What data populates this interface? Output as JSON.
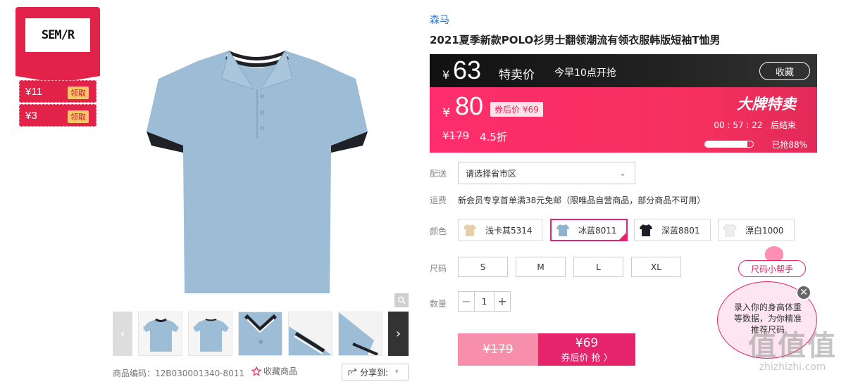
{
  "brand_badge": {
    "logo": "SEM/R"
  },
  "coupons": [
    {
      "amount": "¥11",
      "action": "领取"
    },
    {
      "amount": "¥3",
      "action": "领取"
    }
  ],
  "product": {
    "brand": "森马",
    "title": "2021夏季新款POLO衫男士翻领潮流有领衣服韩版短袖T恤男",
    "sku_label": "商品编码：",
    "sku": "12B030001340-8011",
    "favorite_label": "收藏商品",
    "share_label": "分享到:"
  },
  "flash": {
    "currency": "¥",
    "flash_price": "63",
    "flash_label": "特卖价",
    "flash_start": "今早10点开抢",
    "favorite_button": "收藏",
    "current_price": "80",
    "after_coupon": "券后价 ¥69",
    "original_price": "¥179",
    "discount": "4.5折",
    "event_name": "大牌特卖",
    "countdown": "00 : 57 : 22",
    "countdown_suffix": "后结束",
    "sold_percent": 88,
    "sold_text": "已抢88%"
  },
  "delivery": {
    "label": "配送",
    "placeholder": "请选择省市区"
  },
  "shipping": {
    "label": "运费",
    "text": "新会员专享首单满38元免邮（限唯品自营商品，部分商品不可用）"
  },
  "colors": {
    "label": "颜色",
    "options": [
      {
        "name": "浅卡其5314",
        "swatch": "#e7cfa9",
        "selected": false
      },
      {
        "name": "冰蓝8011",
        "swatch": "#8fb3cf",
        "selected": true
      },
      {
        "name": "深蓝8801",
        "swatch": "#1e1f26",
        "selected": false
      },
      {
        "name": "漂白1000",
        "swatch": "#eeeeee",
        "selected": false
      }
    ]
  },
  "sizes": {
    "label": "尺码",
    "options": [
      "S",
      "M",
      "L",
      "XL"
    ]
  },
  "quantity": {
    "label": "数量",
    "value": "1",
    "minus": "−",
    "plus": "+"
  },
  "buy": {
    "original": "¥179",
    "price": "¥69",
    "cta": "券后价 抢 〉"
  },
  "size_helper": {
    "tag": "尺码小帮手",
    "text": "录入你的身高体重等数据，为你精准推荐尺码",
    "close": "✕"
  },
  "watermark": {
    "mark": "值值值",
    "url": "zhizhizhi.com"
  },
  "colors_theme": {
    "accent": "#e5246c",
    "flash_bg": "#f5305e",
    "brand_red": "#e3224a"
  }
}
